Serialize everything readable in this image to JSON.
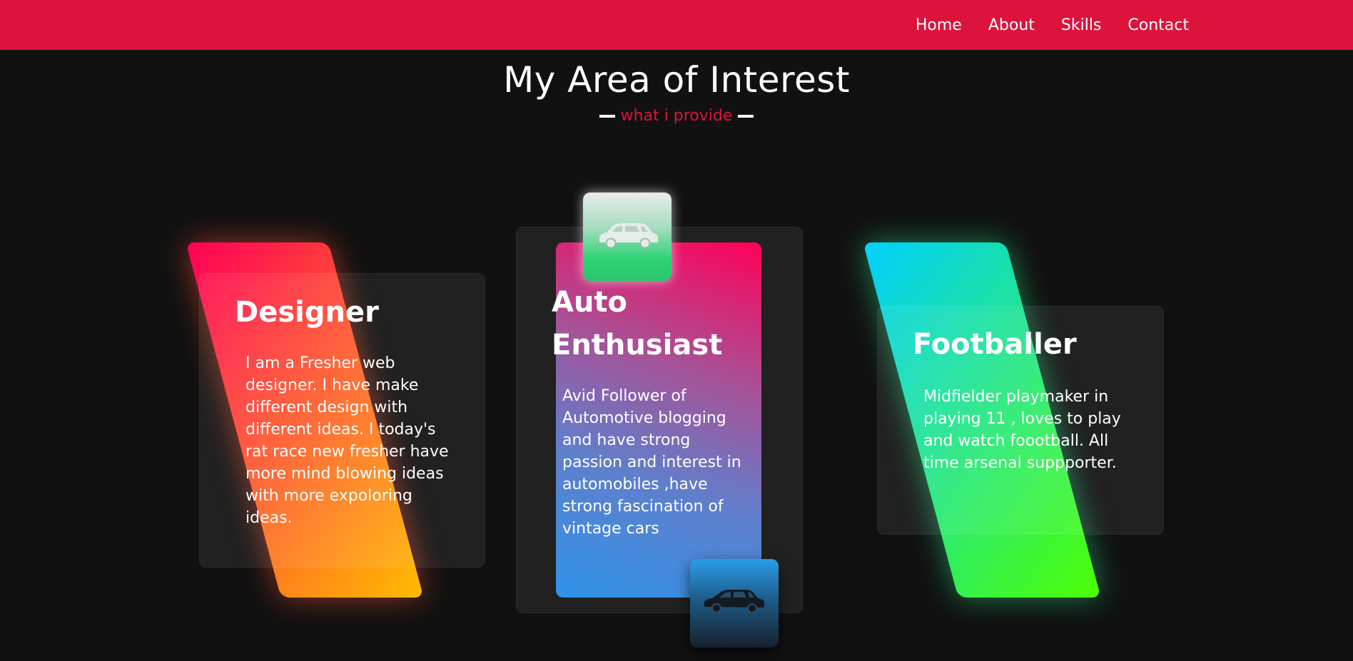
{
  "nav": {
    "items": [
      {
        "label": "Home"
      },
      {
        "label": "About"
      },
      {
        "label": "Skills"
      },
      {
        "label": "Contact"
      }
    ]
  },
  "section": {
    "title": "My Area of Interest",
    "subtitle": "what i provide"
  },
  "cards": [
    {
      "title": "Designer",
      "text": "I am a Fresher web designer. I have make different design with different ideas. I today's rat race new fresher have more mind blowing ideas with more expoloring ideas."
    },
    {
      "title": "Auto Enthusiast",
      "text": "Avid Follower of Automotive blogging and have strong passion and interest in automobiles ,have strong fascination of vintage cars"
    },
    {
      "title": "Footballer",
      "text": "Midfielder playmaker in playing 11 , loves to play and watch foootball. All time arsenal suppporter."
    }
  ],
  "icons": {
    "top_tile": "car-icon",
    "bottom_tile": "car-icon"
  },
  "colors": {
    "accent": "#dc143c",
    "background": "#111111"
  }
}
